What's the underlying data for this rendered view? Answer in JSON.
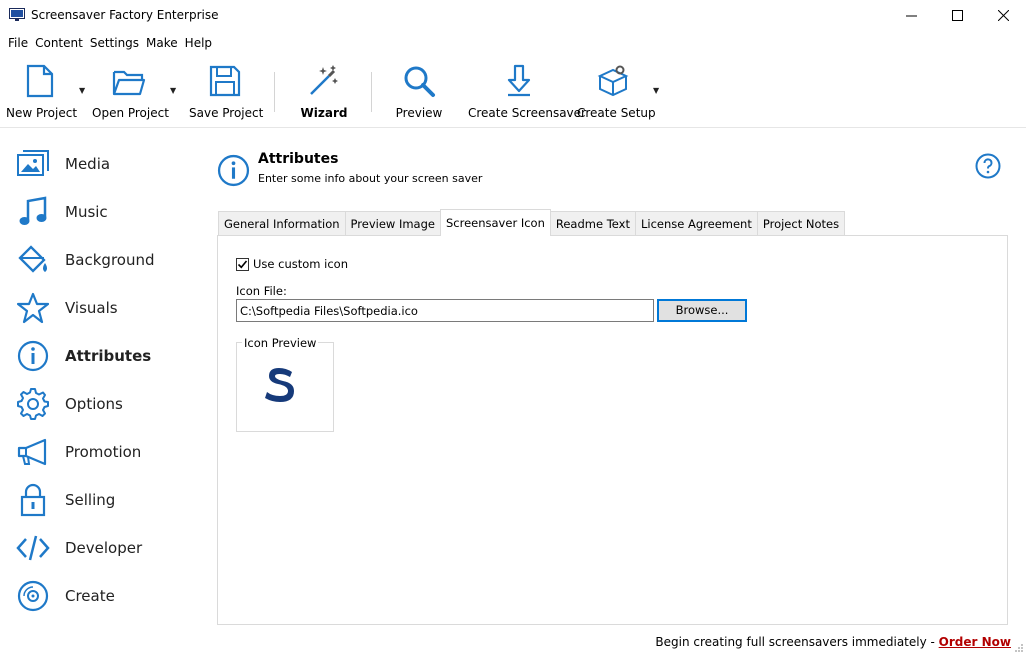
{
  "window": {
    "title": "Screensaver Factory Enterprise",
    "minimize_glyph": "─",
    "maximize_glyph": "☐",
    "close_glyph": "✕"
  },
  "menu": [
    "File",
    "Content",
    "Settings",
    "Make",
    "Help"
  ],
  "toolbar": {
    "new_project": "New Project",
    "open_project": "Open Project",
    "save_project": "Save Project",
    "wizard": "Wizard",
    "preview": "Preview",
    "create_screensaver": "Create Screensaver",
    "create_setup": "Create Setup",
    "dropdown_glyph": "▼"
  },
  "sidebar": {
    "items": [
      {
        "label": "Media",
        "icon": "image-icon"
      },
      {
        "label": "Music",
        "icon": "music-note-icon"
      },
      {
        "label": "Background",
        "icon": "paint-bucket-icon"
      },
      {
        "label": "Visuals",
        "icon": "star-icon"
      },
      {
        "label": "Attributes",
        "icon": "info-icon"
      },
      {
        "label": "Options",
        "icon": "gear-icon"
      },
      {
        "label": "Promotion",
        "icon": "megaphone-icon"
      },
      {
        "label": "Selling",
        "icon": "lock-icon"
      },
      {
        "label": "Developer",
        "icon": "code-icon"
      },
      {
        "label": "Create",
        "icon": "disc-icon"
      }
    ],
    "active": "Attributes"
  },
  "header": {
    "title": "Attributes",
    "subtitle": "Enter some info about your screen saver"
  },
  "tabs": [
    "General Information",
    "Preview Image",
    "Screensaver Icon",
    "Readme Text",
    "License Agreement",
    "Project Notes"
  ],
  "active_tab": "Screensaver Icon",
  "panel": {
    "use_custom_icon_label": "Use custom icon",
    "use_custom_icon_checked": true,
    "icon_file_label": "Icon File:",
    "icon_file_value": "C:\\Softpedia Files\\Softpedia.ico",
    "browse_label": "Browse...",
    "icon_preview_label": "Icon Preview"
  },
  "footer": {
    "text": "Begin creating full screensavers immediately - ",
    "link": "Order Now"
  },
  "colors": {
    "accent": "#1f79c8",
    "link": "#b20000",
    "preview_s": "#163a7a"
  }
}
